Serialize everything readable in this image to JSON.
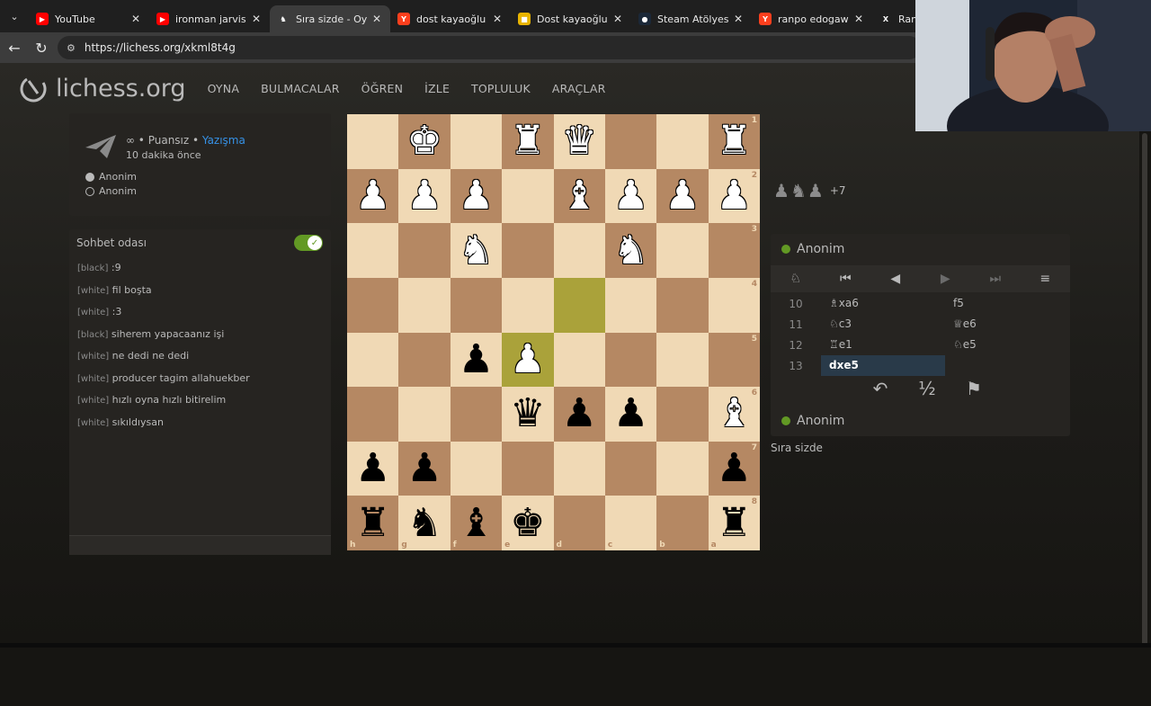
{
  "browser": {
    "tabs": [
      {
        "label": "YouTube",
        "icon": "youtube-icon",
        "color": "#ff0000",
        "glyph": "▶",
        "active": false
      },
      {
        "label": "ironman jarvis - You",
        "icon": "youtube-icon",
        "color": "#ff0000",
        "glyph": "▶",
        "active": false
      },
      {
        "label": "Sıra sizde - Oyna A",
        "icon": "lichess-icon",
        "color": "#3c3c3c",
        "glyph": "♞",
        "active": true
      },
      {
        "label": "dost kayaoğlu erikli",
        "icon": "yandex-icon",
        "color": "#fc3f1d",
        "glyph": "Y",
        "active": false
      },
      {
        "label": "Dost kayaoğlu erikl",
        "icon": "folder-icon",
        "color": "#e8b400",
        "glyph": "■",
        "active": false
      },
      {
        "label": "Steam Atölyesi::Dos",
        "icon": "steam-icon",
        "color": "#1b2838",
        "glyph": "●",
        "active": false
      },
      {
        "label": "ranpo edogawa —",
        "icon": "yandex-icon",
        "color": "#fc3f1d",
        "glyph": "Y",
        "active": false
      },
      {
        "label": "Ranpo",
        "icon": "x-icon",
        "color": "#1f1f1f",
        "glyph": "X",
        "active": false
      }
    ],
    "url": "https://lichess.org/xkml8t4g"
  },
  "site": {
    "logo_text": "lichess.org",
    "nav": [
      "OYNA",
      "BULMACALAR",
      "ÖĞREN",
      "İZLE",
      "TOPLULUK",
      "ARAÇLAR"
    ]
  },
  "game_info": {
    "mode_prefix": "∞ • Puansız • ",
    "mode_link": "Yazışma",
    "time_ago": "10 dakika önce",
    "players": [
      "Anonim",
      "Anonim"
    ]
  },
  "chat": {
    "title": "Sohbet odası",
    "enabled": true,
    "messages": [
      {
        "user": "[black]",
        "text": ":9"
      },
      {
        "user": "[white]",
        "text": "fil boşta"
      },
      {
        "user": "[white]",
        "text": ":3"
      },
      {
        "user": "[black]",
        "text": "siherem yapacaanız işi"
      },
      {
        "user": "[white]",
        "text": "ne dedi ne dedi"
      },
      {
        "user": "[white]",
        "text": "producer tagim allahuekber"
      },
      {
        "user": "[white]",
        "text": "hızlı oyna hızlı bitirelim"
      },
      {
        "user": "[white]",
        "text": "sıkıldıysan"
      }
    ]
  },
  "board": {
    "orientation": "black",
    "rows": [
      [
        "",
        "wK",
        "",
        "wR",
        "wQ",
        "",
        "",
        "wR"
      ],
      [
        "wP",
        "wP",
        "wP",
        "",
        "wB",
        "wP",
        "wP",
        "wP"
      ],
      [
        "",
        "",
        "wN",
        "",
        "",
        "wN",
        "",
        ""
      ],
      [
        "",
        "",
        "",
        "",
        "",
        "",
        "",
        ""
      ],
      [
        "",
        "",
        "bP",
        "wP",
        "",
        "",
        "",
        ""
      ],
      [
        "",
        "",
        "",
        "bQ",
        "bP",
        "bP",
        "",
        "wB"
      ],
      [
        "bP",
        "bP",
        "",
        "",
        "",
        "",
        "",
        "bP"
      ],
      [
        "bR",
        "bN",
        "bB",
        "bK",
        "",
        "",
        "",
        "bR"
      ]
    ],
    "highlights": [
      [
        3,
        4
      ],
      [
        4,
        3
      ]
    ],
    "rank_labels": [
      "1",
      "2",
      "3",
      "4",
      "5",
      "6",
      "7",
      "8"
    ],
    "file_labels": [
      "h",
      "g",
      "f",
      "e",
      "d",
      "c",
      "b",
      "a"
    ],
    "light_color": "#f0d9b5",
    "dark_color": "#b58863"
  },
  "material": {
    "pieces": [
      "♟",
      "♞",
      "♟"
    ],
    "advantage": "+7"
  },
  "moves_panel": {
    "top_player": "Anonim",
    "bottom_player": "Anonim",
    "moves": [
      {
        "num": "10",
        "white": "♗xa6",
        "black": "f5"
      },
      {
        "num": "11",
        "white": "♘c3",
        "black": "♕e6"
      },
      {
        "num": "12",
        "white": "♖e1",
        "black": "♘e5"
      },
      {
        "num": "13",
        "white": "dxe5",
        "black": ""
      }
    ],
    "current_move": "13-white"
  },
  "status": {
    "turn_text": "Sıra sizde"
  }
}
